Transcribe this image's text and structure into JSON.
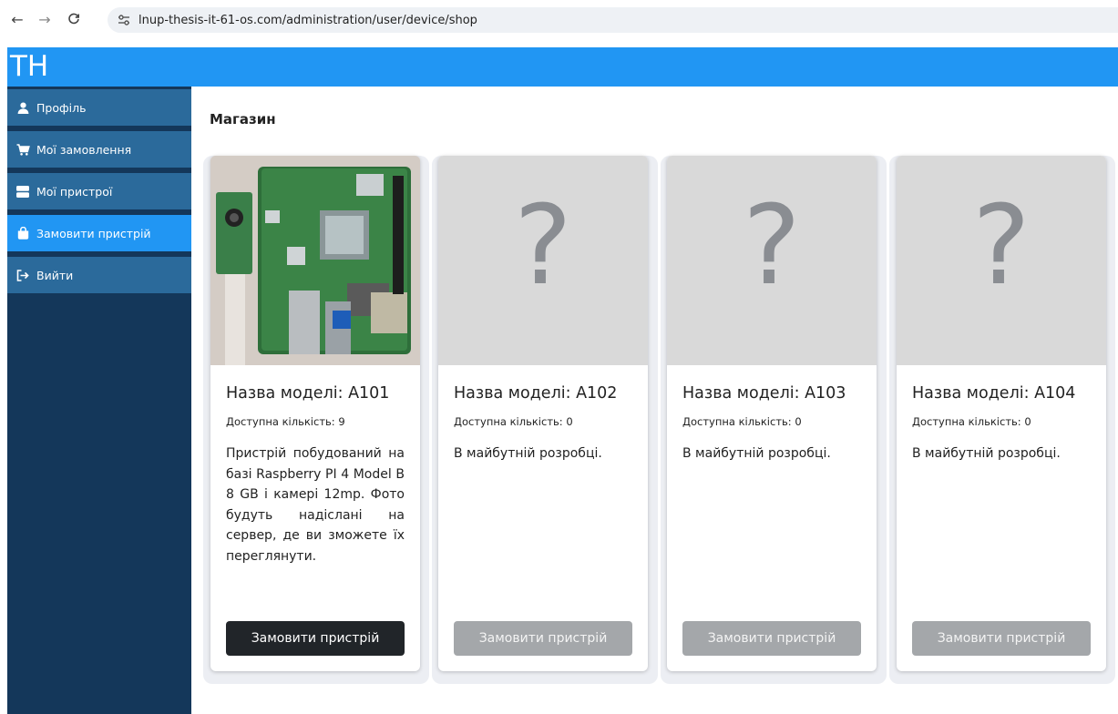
{
  "browser": {
    "url": "lnup-thesis-it-61-os.com/administration/user/device/shop"
  },
  "app": {
    "logo": "TH"
  },
  "sidebar": {
    "items": [
      {
        "label": "Профіль",
        "icon": "user-icon"
      },
      {
        "label": "Мої замовлення",
        "icon": "cart-icon"
      },
      {
        "label": "Мої пристрої",
        "icon": "server-icon"
      },
      {
        "label": "Замовити пристрій",
        "icon": "shopping-bag-icon",
        "active": true
      },
      {
        "label": "Вийти",
        "icon": "logout-icon"
      }
    ]
  },
  "main": {
    "title": "Магазин",
    "cards": [
      {
        "title": "Назва моделі: A101",
        "quantity": "Доступна кількість: 9",
        "description": "Пристрій побудований на базі Raspberry PI 4 Model B 8 GB і камері 12mp. Фото будуть надіслані на сервер, де ви зможете їх переглянути.",
        "button": "Замовити пристрій",
        "button_enabled": true,
        "image": "raspberry-pi-photo"
      },
      {
        "title": "Назва моделі: A102",
        "quantity": "Доступна кількість: 0",
        "description": "В майбутній розробці.",
        "button": "Замовити пристрій",
        "button_enabled": false,
        "image_placeholder": "?"
      },
      {
        "title": "Назва моделі: A103",
        "quantity": "Доступна кількість: 0",
        "description": "В майбутній розробці.",
        "button": "Замовити пристрій",
        "button_enabled": false,
        "image_placeholder": "?"
      },
      {
        "title": "Назва моделі: A104",
        "quantity": "Доступна кількість: 0",
        "description": "В майбутній розробці.",
        "button": "Замовити пристрій",
        "button_enabled": false,
        "image_placeholder": "?"
      }
    ]
  },
  "colors": {
    "appbar": "#2196f3",
    "sidebar_bg": "#14375a",
    "sidebar_item": "#2b6a9b",
    "sidebar_active": "#2196f3",
    "button_enabled": "#212529",
    "button_disabled": "#a4a7aa"
  }
}
